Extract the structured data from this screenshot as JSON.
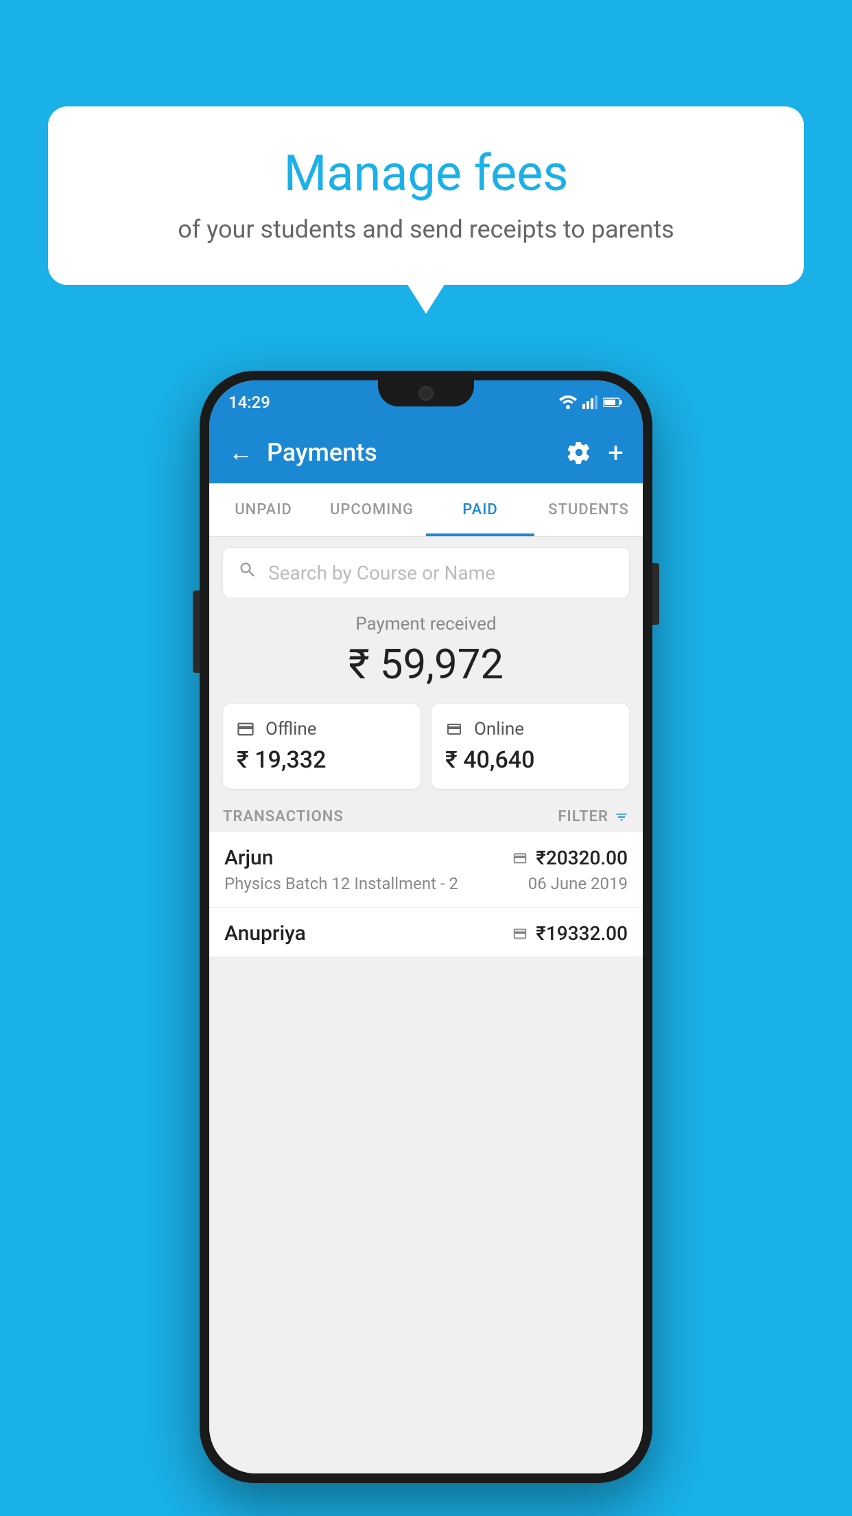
{
  "background_color": "#1ab0e8",
  "bubble": {
    "title": "Manage fees",
    "subtitle": "of your students and send receipts to parents"
  },
  "status_bar": {
    "time": "14:29",
    "wifi": "▼",
    "signal": "▲",
    "battery": "▮"
  },
  "app_bar": {
    "title": "Payments",
    "back_label": "←",
    "plus_label": "+",
    "gear_label": "⚙"
  },
  "tabs": [
    {
      "label": "UNPAID",
      "active": false
    },
    {
      "label": "UPCOMING",
      "active": false
    },
    {
      "label": "PAID",
      "active": true
    },
    {
      "label": "STUDENTS",
      "active": false
    }
  ],
  "search": {
    "placeholder": "Search by Course or Name"
  },
  "payment_summary": {
    "label": "Payment received",
    "total": "₹ 59,972",
    "offline": {
      "label": "Offline",
      "amount": "₹ 19,332"
    },
    "online": {
      "label": "Online",
      "amount": "₹ 40,640"
    }
  },
  "transactions_section": {
    "label": "TRANSACTIONS",
    "filter_label": "FILTER"
  },
  "transactions": [
    {
      "name": "Arjun",
      "course": "Physics Batch 12 Installment - 2",
      "amount": "₹20320.00",
      "date": "06 June 2019",
      "payment_type": "online"
    },
    {
      "name": "Anupriya",
      "course": "",
      "amount": "₹19332.00",
      "date": "",
      "payment_type": "offline"
    }
  ]
}
